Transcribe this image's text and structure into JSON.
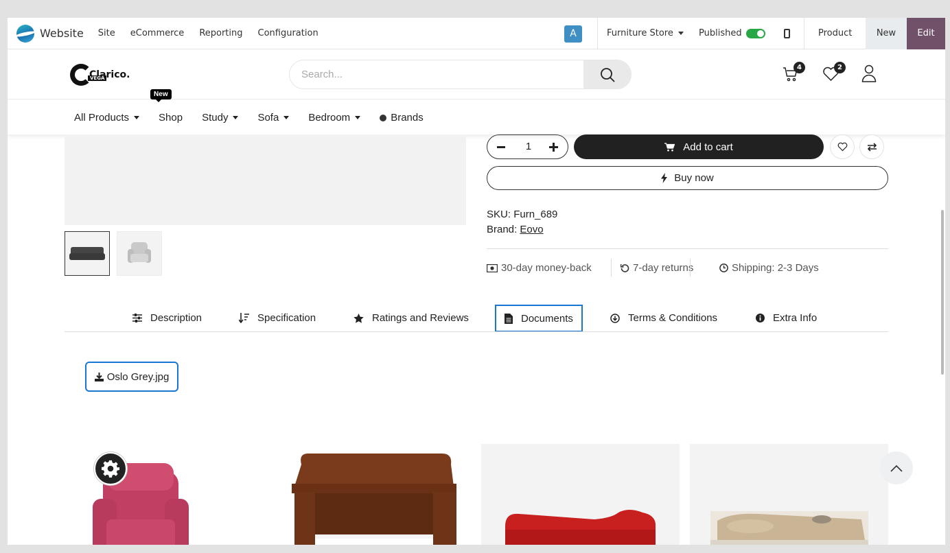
{
  "topbar": {
    "app_name": "Website",
    "menu": [
      "Site",
      "eCommerce",
      "Reporting",
      "Configuration"
    ],
    "avatar_letter": "A",
    "store": "Furniture Store",
    "published_label": "Published",
    "published": true,
    "product_label": "Product",
    "new_label": "New",
    "edit_label": "Edit",
    "accent": "#71506a"
  },
  "header": {
    "brand": "Clarico.",
    "brand_sub": "VEGA",
    "search_placeholder": "Search...",
    "cart_count": "4",
    "wishlist_count": "2"
  },
  "catnav": {
    "items": [
      "All Products",
      "Shop",
      "Study",
      "Sofa",
      "Bedroom",
      "Brands"
    ],
    "new_tag": "New"
  },
  "product": {
    "quantity": "1",
    "add_to_cart": "Add to cart",
    "buy_now": "Buy now",
    "sku_label": "SKU:",
    "sku": "Furn_689",
    "brand_label": "Brand:",
    "brand": "Eovo",
    "policies": [
      "30-day money-back",
      "7-day returns",
      "Shipping: 2-3 Days"
    ]
  },
  "tabs": {
    "items": [
      "Description",
      "Specification",
      "Ratings and Reviews",
      "Documents",
      "Terms & Conditions",
      "Extra Info"
    ],
    "active": "Documents"
  },
  "documents": {
    "file": "Oslo Grey.jpg"
  }
}
